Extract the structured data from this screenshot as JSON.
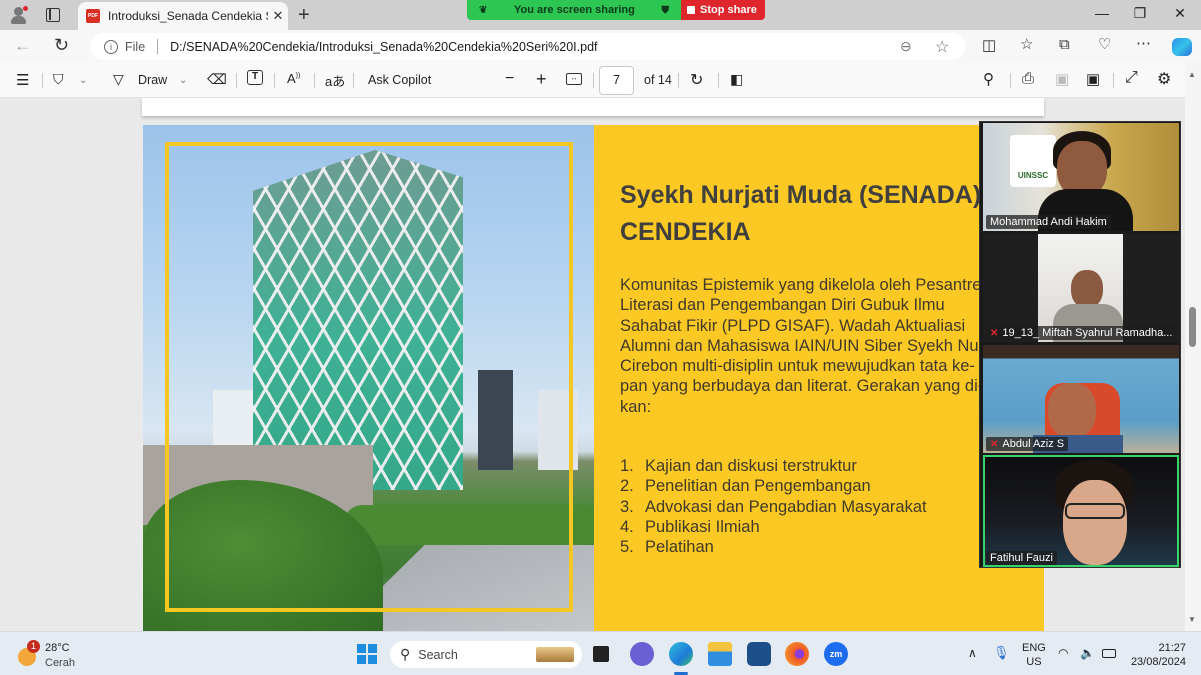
{
  "browser": {
    "tab_title": "Introduksi_Senada Cendekia Seri",
    "tab_close": "✕",
    "new_tab": "+",
    "address_prefix": "File",
    "address_url": "D:/SENADA%20Cendekia/Introduksi_Senada%20Cendekia%20Seri%20I.pdf",
    "window_controls": {
      "minimize": "—",
      "restore": "❐",
      "close": "✕"
    },
    "toolbar_icons": [
      "split-screen-icon",
      "favorites-icon",
      "collections-icon",
      "browser-essentials-icon",
      "more-icon",
      "copilot-icon"
    ]
  },
  "screen_share": {
    "status": "You are screen sharing",
    "stop_label": "Stop share"
  },
  "pdf_toolbar": {
    "draw_label": "Draw",
    "ask_copilot_label": "Ask Copilot",
    "zoom_out": "−",
    "zoom_in": "+",
    "current_page": "7",
    "page_total_label": "of 14"
  },
  "slide": {
    "title_line1": "Syekh Nurjati Muda (SENADA)",
    "title_line2": "CENDEKIA",
    "body_lines": [
      "Komunitas Epistemik yang dikelola oleh Pesantren",
      "Literasi dan Pengembangan Diri Gubuk Ilmu",
      "Sahabat Fikir (PLPD GISAF). Wadah Aktualiasi",
      "Alumni dan Mahasiswa IAIN/UIN Siber Syekh Nurjati",
      "Cirebon  multi-disiplin untuk mewujudkan tata ke-",
      "pan yang berbudaya dan literat. Gerakan yang di-",
      "kan:"
    ],
    "list": [
      {
        "num": "1.",
        "text": "Kajian dan diskusi terstruktur"
      },
      {
        "num": "2.",
        "text": "Penelitian dan Pengembangan"
      },
      {
        "num": "3.",
        "text": "Advokasi dan Pengabdian Masyarakat"
      },
      {
        "num": "4.",
        "text": "Publikasi Ilmiah"
      },
      {
        "num": "5.",
        "text": "Pelatihan"
      }
    ],
    "photo_logo_text": "UINSSC"
  },
  "participants": [
    {
      "name": "Mohammad Andi Hakim",
      "muted": false,
      "active": false
    },
    {
      "name": "19_13_ Miftah Syahrul Ramadha...",
      "muted": true,
      "active": false
    },
    {
      "name": "Abdul Aziz S",
      "muted": true,
      "active": false
    },
    {
      "name": "Fatihul Fauzi",
      "muted": false,
      "active": true
    }
  ],
  "taskbar": {
    "weather_badge": "1",
    "weather_temp": "28°C",
    "weather_desc": "Cerah",
    "search_label": "Search",
    "lang_line1": "ENG",
    "lang_line2": "US",
    "time": "21:27",
    "date": "23/08/2024"
  }
}
